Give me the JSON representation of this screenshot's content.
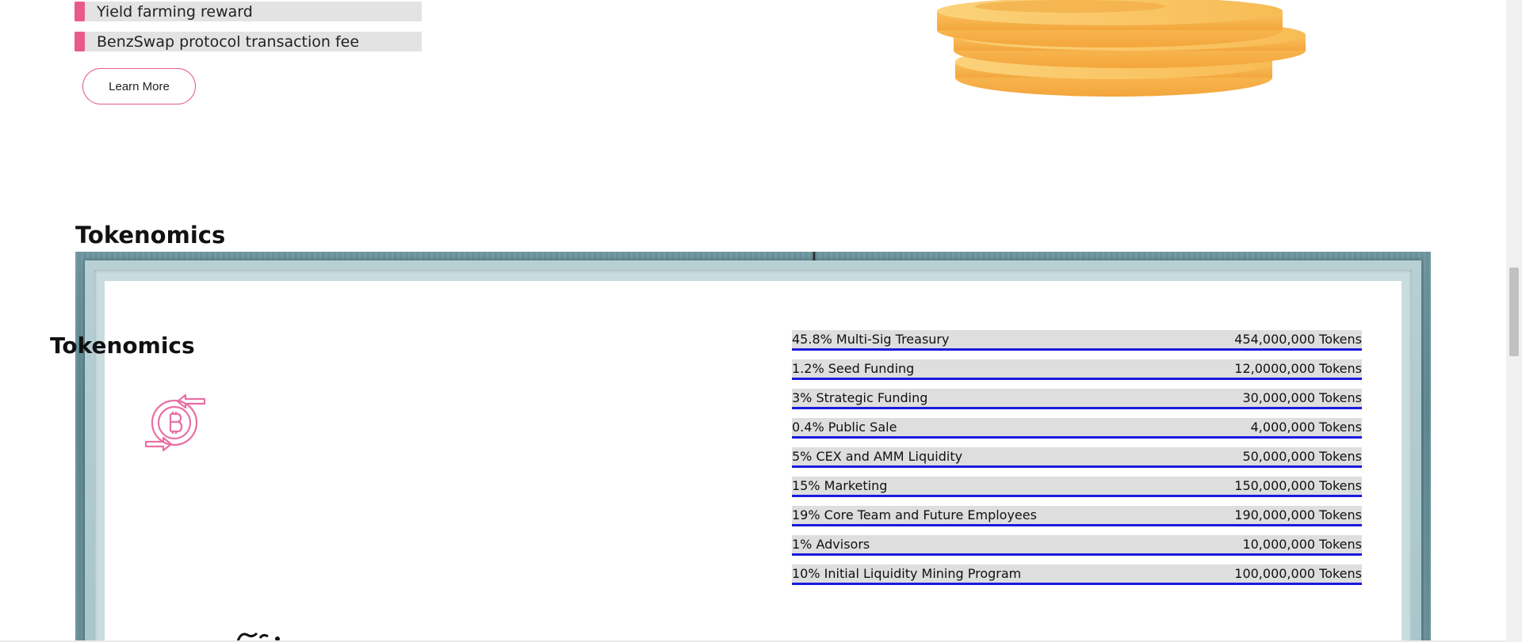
{
  "features": [
    {
      "label": "Yield farming reward"
    },
    {
      "label": "BenzSwap protocol transaction fee"
    }
  ],
  "learn_more_label": "Learn More",
  "section_heading": "Tokenomics",
  "card": {
    "title": "Tokenomics",
    "allocations": [
      {
        "label": "45.8% Multi-Sig Treasury",
        "amount": "454,000,000 Tokens"
      },
      {
        "label": "1.2% Seed Funding",
        "amount": "12,0000,000 Tokens"
      },
      {
        "label": "3% Strategic Funding",
        "amount": "30,000,000 Tokens"
      },
      {
        "label": "0.4% Public Sale",
        "amount": "4,000,000 Tokens"
      },
      {
        "label": "5% CEX and AMM Liquidity",
        "amount": "50,000,000 Tokens"
      },
      {
        "label": "15% Marketing",
        "amount": "150,000,000 Tokens"
      },
      {
        "label": "19% Core Team and Future Employees",
        "amount": "190,000,000 Tokens"
      },
      {
        "label": "1% Advisors",
        "amount": "10,000,000 Tokens"
      },
      {
        "label": "10% Initial Liquidity Mining Program",
        "amount": "100,000,000 Tokens"
      }
    ]
  },
  "colors": {
    "accent_pink": "#e85a8c",
    "underline_blue": "#1a1ae0",
    "row_bg": "#dedede",
    "coin_orange": "#f7b24c"
  },
  "icons": [
    "coins-stack-image",
    "bitcoin-exchange-icon"
  ]
}
